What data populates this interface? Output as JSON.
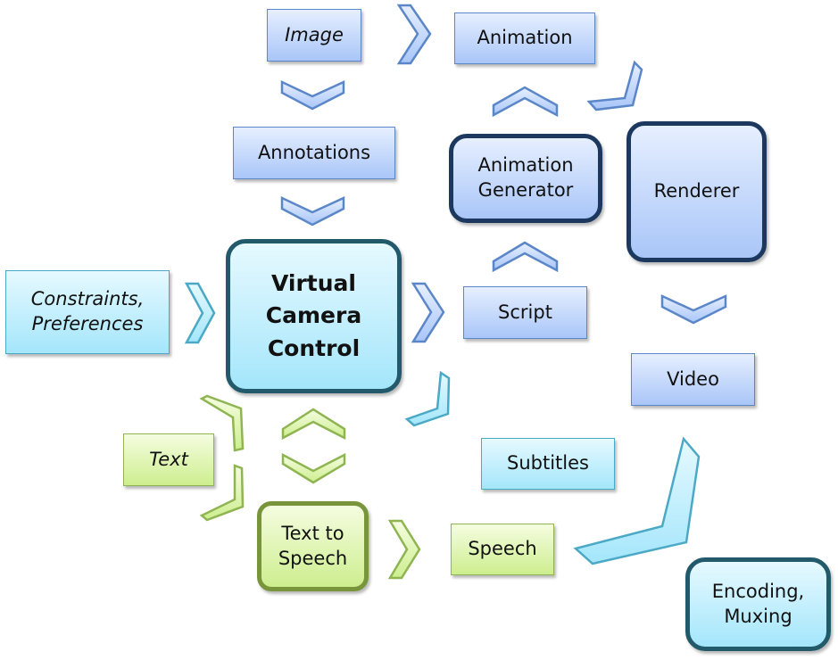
{
  "diagram": {
    "colors": {
      "blue_fill_top": "#e6efff",
      "blue_fill_bottom": "#a9c6f8",
      "blue_stroke": "#5b87c9",
      "cyan_fill_top": "#e6f9ff",
      "cyan_fill_bottom": "#a4e6fb",
      "cyan_stroke": "#4ba9c6",
      "green_fill_top": "#f5fde0",
      "green_fill_bottom": "#cdee8f",
      "green_stroke": "#8fb553"
    },
    "nodes": {
      "image": "Image",
      "animation": "Animation",
      "annotations": "Annotations",
      "animation_generator": "Animation\nGenerator",
      "renderer": "Renderer",
      "constraints": "Constraints,\nPreferences",
      "virtual_camera_control": "Virtual\nCamera\nControl",
      "script": "Script",
      "video": "Video",
      "text": "Text",
      "subtitles": "Subtitles",
      "text_to_speech": "Text to\nSpeech",
      "speech": "Speech",
      "encoding_muxing": "Encoding,\nMuxing"
    },
    "edges": [
      {
        "from": "Image",
        "to": "Animation"
      },
      {
        "from": "Image",
        "to": "Annotations"
      },
      {
        "from": "Annotations",
        "to": "Virtual Camera Control"
      },
      {
        "from": "Constraints, Preferences",
        "to": "Virtual Camera Control"
      },
      {
        "from": "Virtual Camera Control",
        "to": "Script"
      },
      {
        "from": "Script",
        "to": "Animation Generator"
      },
      {
        "from": "Animation Generator",
        "to": "Animation"
      },
      {
        "from": "Animation",
        "to": "Renderer"
      },
      {
        "from": "Renderer",
        "to": "Video"
      },
      {
        "from": "Virtual Camera Control",
        "to": "Subtitles"
      },
      {
        "from": "Text",
        "to": "Virtual Camera Control"
      },
      {
        "from": "Text",
        "to": "Text to Speech"
      },
      {
        "from": "Virtual Camera Control",
        "to": "Text to Speech",
        "bidirectional": true
      },
      {
        "from": "Text to Speech",
        "to": "Speech"
      },
      {
        "from": "Speech",
        "to": "Video"
      }
    ]
  }
}
